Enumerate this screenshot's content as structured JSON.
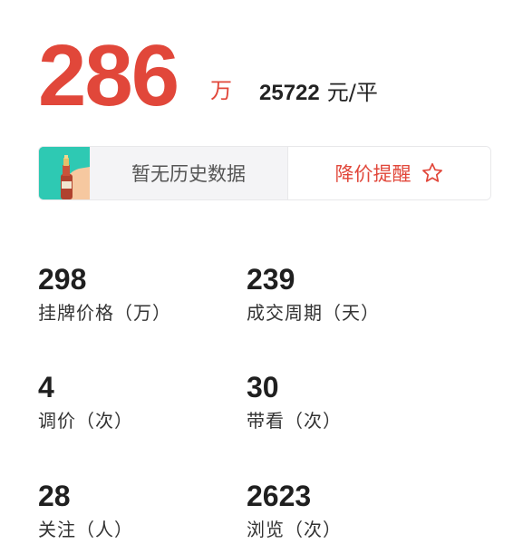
{
  "price": {
    "total": "286",
    "total_unit": "万",
    "per_sqm_value": "25722",
    "per_sqm_unit": "元/平"
  },
  "history": {
    "empty_text": "暂无历史数据",
    "alert_label": "降价提醒",
    "thumb_icon": "bottle-thumbnail-icon",
    "alert_icon": "star-icon",
    "accent": "#e1473a",
    "thumb_bg": "#2ec9b3"
  },
  "stats": [
    {
      "value": "298",
      "label": "挂牌价格（万）"
    },
    {
      "value": "239",
      "label": "成交周期（天）"
    },
    {
      "value": "4",
      "label": "调价（次）"
    },
    {
      "value": "30",
      "label": "带看（次）"
    },
    {
      "value": "28",
      "label": "关注（人）"
    },
    {
      "value": "2623",
      "label": "浏览（次）"
    }
  ]
}
